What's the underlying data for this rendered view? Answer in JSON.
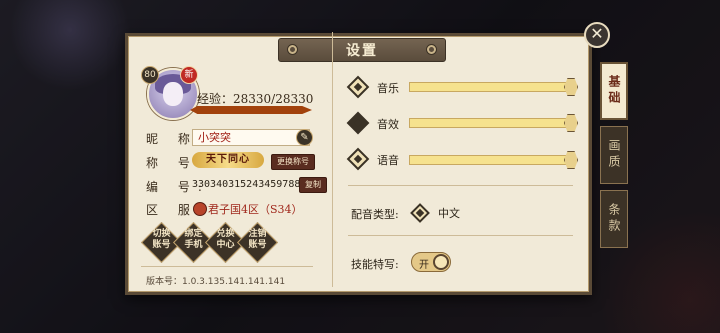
{
  "window": {
    "title": "设置"
  },
  "profile": {
    "level": "80",
    "new_badge": "新",
    "exp_label": "经验：28330/28330",
    "exp_fraction": 1.0,
    "nickname_label": "昵 称:",
    "nickname_value": "小突突",
    "title_label": "称 号:",
    "title_badge": "天下同心",
    "change_title_button": "更换称号",
    "id_label": "编 号:",
    "id_value": "3303403152434597888",
    "copy_button": "复制",
    "server_label": "区 服:",
    "server_value": "君子国4区（S34）",
    "account_buttons": [
      {
        "line1": "切换",
        "line2": "账号"
      },
      {
        "line1": "绑定",
        "line2": "手机"
      },
      {
        "line1": "兑换",
        "line2": "中心"
      },
      {
        "line1": "注销",
        "line2": "账号"
      }
    ],
    "version": "版本号：1.0.3.135.141.141.141"
  },
  "audio": {
    "music": {
      "label": "音乐",
      "level": 1.0
    },
    "sfx": {
      "label": "音效",
      "level": 1.0
    },
    "voice": {
      "label": "语音",
      "level": 1.0
    }
  },
  "voice_type": {
    "label": "配音类型:",
    "value": "中文"
  },
  "skill_text": {
    "label": "技能特写:",
    "toggle_text": "开",
    "on": true
  },
  "tabs": [
    {
      "label": "基础",
      "active": true
    },
    {
      "label": "画质",
      "active": false
    },
    {
      "label": "条款",
      "active": false
    }
  ],
  "colors": {
    "panel": "#f1ead8",
    "accent_red": "#a01e14",
    "slider": "#f6e28e"
  },
  "icons": {
    "close": "close-icon",
    "edit": "pencil-icon"
  }
}
